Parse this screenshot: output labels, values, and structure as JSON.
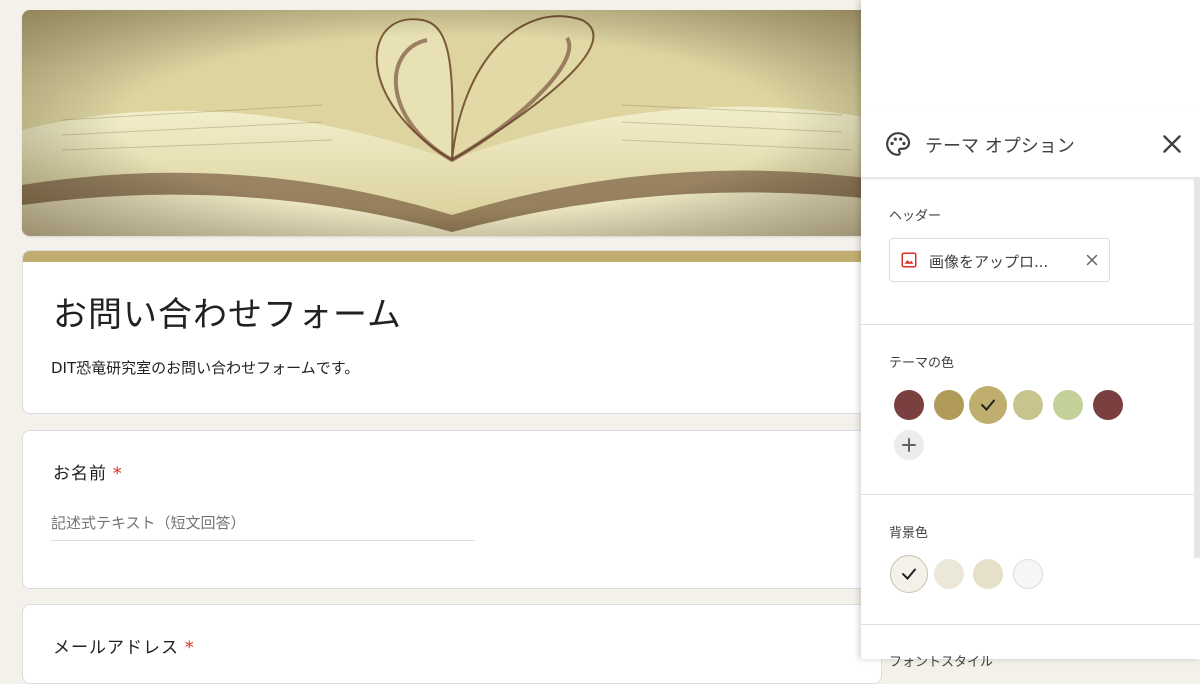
{
  "form": {
    "title": "お問い合わせフォーム",
    "description": "DIT恐竜研究室のお問い合わせフォームです。",
    "accent_color": "#c1ad70",
    "questions": [
      {
        "label": "お名前",
        "required_mark": "*",
        "placeholder": "記述式テキスト（短文回答）"
      },
      {
        "label": "メールアドレス",
        "required_mark": "*"
      }
    ]
  },
  "theme_panel": {
    "title": "テーマ オプション",
    "icon": "palette-icon",
    "close_icon": "close-icon",
    "header_section": {
      "label": "ヘッダー",
      "upload_label": "画像をアップロ...",
      "upload_icon": "image-icon"
    },
    "theme_color_section": {
      "label": "テーマの色",
      "colors": [
        "#7a4040",
        "#b09a58",
        "#bfae6e",
        "#c9c48e",
        "#c3d097",
        "#7a4040"
      ],
      "selected_index": 2
    },
    "background_section": {
      "label": "背景色",
      "colors": [
        "#f3f1ea",
        "#ece8d8",
        "#e6e0c8",
        "#f6f6f6"
      ],
      "selected_index": 0
    },
    "font_section": {
      "label": "フォントスタイル"
    }
  }
}
